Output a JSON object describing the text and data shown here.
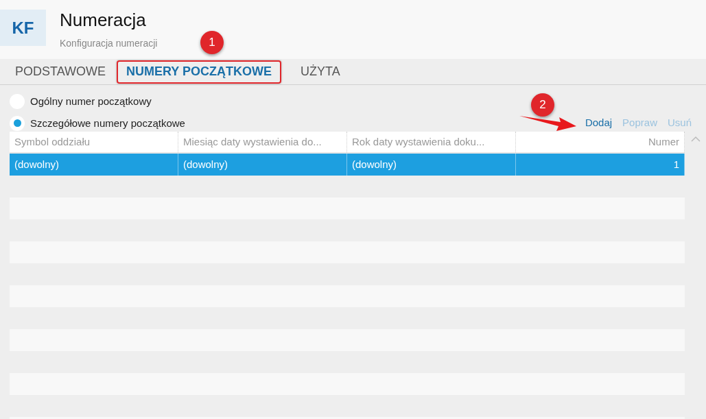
{
  "header": {
    "logo": "KF",
    "title": "Numeracja",
    "subtitle": "Konfiguracja numeracji"
  },
  "tabs": [
    {
      "label": "PODSTAWOWE",
      "selected": false,
      "highlighted": false
    },
    {
      "label": "NUMERY POCZĄTKOWE",
      "selected": true,
      "highlighted": true
    },
    {
      "label": "UŻYTA",
      "selected": false,
      "highlighted": false
    }
  ],
  "options": [
    {
      "label": "Ogólny numer początkowy",
      "selected": false
    },
    {
      "label": "Szczegółowe numery początkowe",
      "selected": true
    }
  ],
  "actions": [
    {
      "label": "Dodaj",
      "disabled": false
    },
    {
      "label": "Popraw",
      "disabled": true
    },
    {
      "label": "Usuń",
      "disabled": true
    }
  ],
  "table": {
    "columns": [
      {
        "label": "Symbol oddziału",
        "kind": "text"
      },
      {
        "label": "Miesiąc daty wystawienia do...",
        "kind": "text"
      },
      {
        "label": "Rok daty wystawienia doku...",
        "kind": "text"
      },
      {
        "label": "Numer",
        "kind": "number"
      }
    ],
    "rows": [
      {
        "selected": true,
        "cells": [
          "(dowolny)",
          "(dowolny)",
          "(dowolny)",
          "1"
        ]
      }
    ]
  },
  "annotations": [
    "1",
    "2"
  ]
}
